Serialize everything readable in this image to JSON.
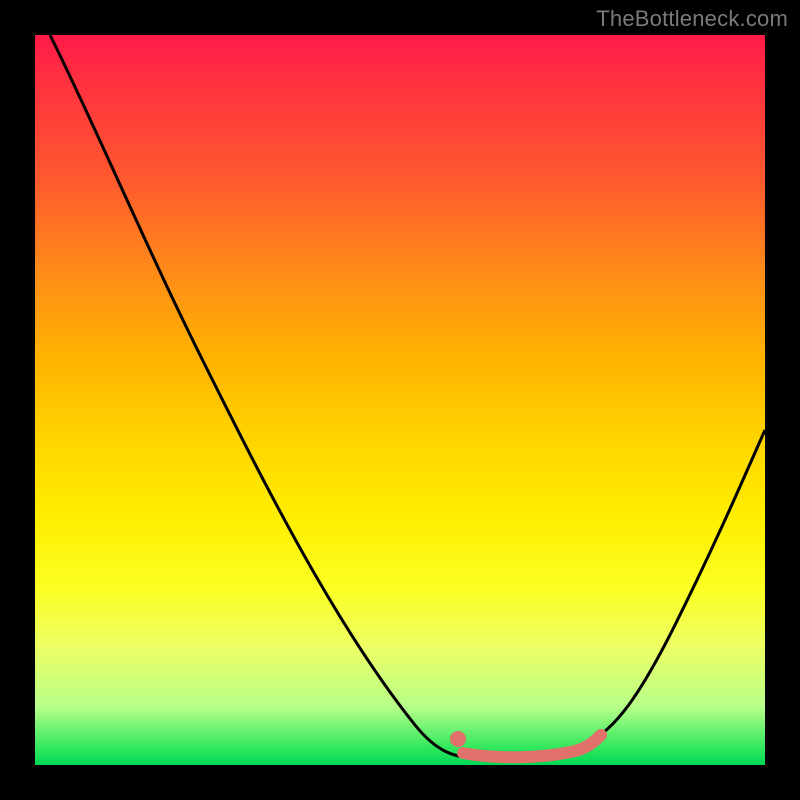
{
  "watermark": "TheBottleneck.com",
  "colors": {
    "curve": "#000000",
    "highlight": "#e2716c",
    "dot": "#e2716c"
  },
  "chart_data": {
    "type": "line",
    "title": "",
    "xlabel": "",
    "ylabel": "",
    "xlim": [
      0,
      100
    ],
    "ylim": [
      0,
      100
    ],
    "series": [
      {
        "name": "bottleneck-curve",
        "x": [
          0,
          5,
          10,
          15,
          20,
          25,
          30,
          35,
          40,
          45,
          50,
          55,
          58,
          62,
          66,
          70,
          74,
          78,
          82,
          86,
          90,
          94,
          98,
          100
        ],
        "values": [
          100,
          95,
          89,
          82,
          75,
          68,
          60,
          52,
          44,
          36,
          28,
          19,
          12,
          6,
          2,
          1,
          1,
          2,
          6,
          14,
          24,
          36,
          47,
          52
        ]
      }
    ],
    "annotations": {
      "highlight_segment": {
        "x_start": 59,
        "x_end": 78,
        "y": 2
      },
      "dot": {
        "x": 59,
        "y": 4
      }
    }
  }
}
